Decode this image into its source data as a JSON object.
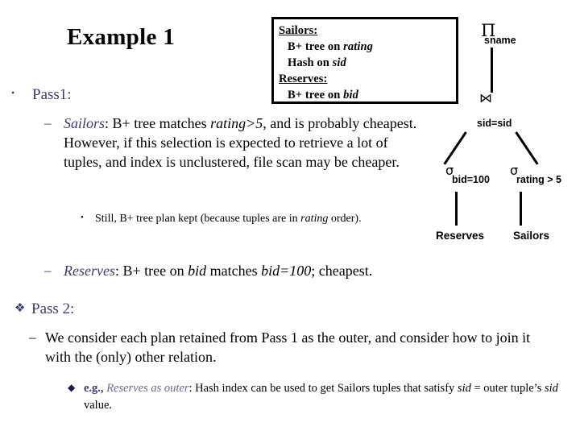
{
  "slide": {
    "title": "Example 1"
  },
  "index_box": {
    "sailors_header": "Sailors:",
    "sailors_line1_pre": "B+ tree on ",
    "sailors_line1_attr": "rating",
    "sailors_line2_pre": "Hash on ",
    "sailors_line2_attr": "sid",
    "reserves_header": "Reserves:",
    "reserves_line1_pre": "B+ tree on ",
    "reserves_line1_attr": "bid"
  },
  "query_tree": {
    "project_symbol": "Π",
    "project_subscript": "sname",
    "join_symbol": "⋈",
    "join_subscript": "sid=sid",
    "select_left_symbol": "σ",
    "select_left_subscript": "bid=100",
    "select_right_symbol": "σ",
    "select_right_subscript": "rating > 5",
    "leaf_left": "Reserves",
    "leaf_right": "Sailors"
  },
  "bullets": {
    "pass1": {
      "marker": "•",
      "label": "Pass1:"
    },
    "sailors_item": {
      "marker": "–",
      "relation": "Sailors",
      "colon": ":",
      "text_a": "  B+ tree matches ",
      "predicate": "rating>5",
      "text_b": ", and is probably cheapest.  However, if this selection is expected to retrieve a lot of tuples, and index is unclustered, file scan may be cheaper."
    },
    "still_item": {
      "marker": "•",
      "text_a": "Still, B+ tree plan kept (because tuples are in ",
      "emph": "rating",
      "text_b": " order)."
    },
    "reserves_item": {
      "marker": "–",
      "relation": "Reserves",
      "colon": ":",
      "text_a": "  B+ tree on ",
      "attr": "bid",
      "text_b": " matches ",
      "predicate": "bid=100",
      "text_c": "; cheapest."
    },
    "pass2": {
      "marker": "❖",
      "label": "Pass 2:"
    },
    "pass2_item": {
      "marker": "–",
      "text": "We consider each plan retained from Pass 1 as the outer, and consider how to join it with the (only) other relation."
    },
    "eg_item": {
      "marker": "◆",
      "eg_label": "e.g., ",
      "relation": "Reserves as outer",
      "colon": ":",
      "text_a": "  Hash index can be used to get Sailors tuples that satisfy ",
      "attr1": "sid",
      "text_b": " = outer tuple’s ",
      "attr2": "sid",
      "text_c": " value."
    }
  },
  "colors": {
    "accent_blue": "#3b3b6d",
    "text_black": "#000000",
    "background": "#ffffff"
  }
}
